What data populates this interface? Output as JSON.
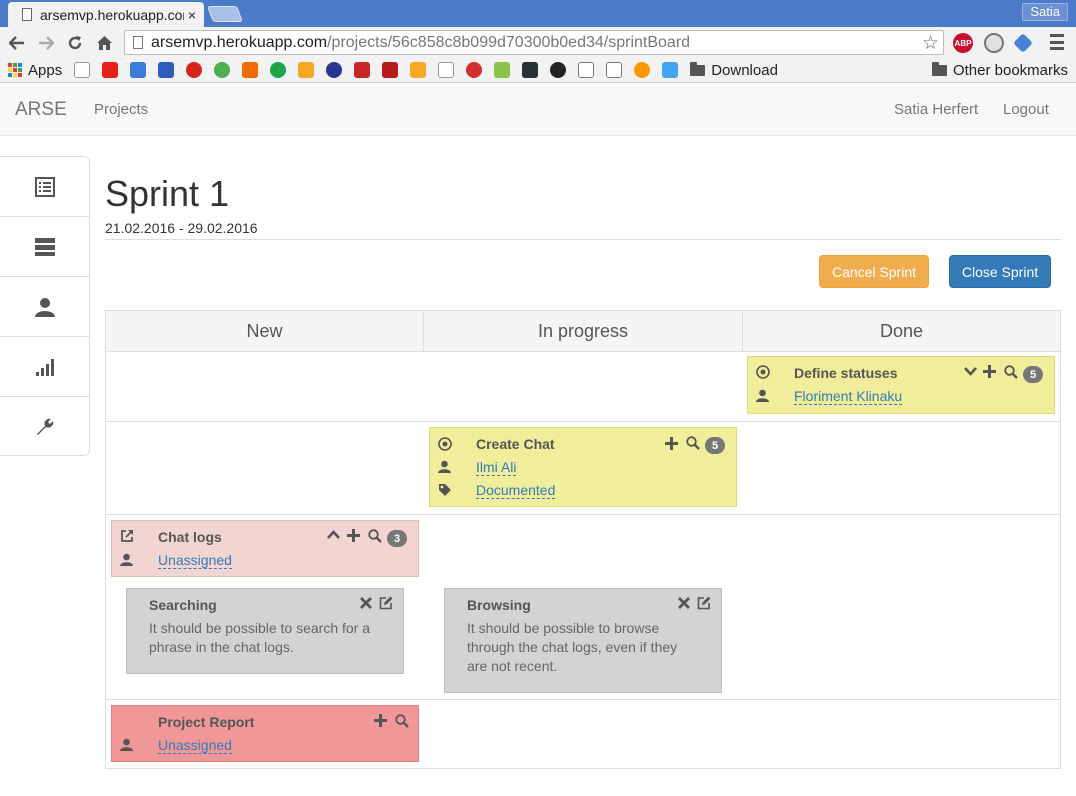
{
  "browser": {
    "tab_title": "arsemvp.herokuapp.com/projects/56c858c8b099d70300b0ed34/sprintBoard",
    "tab_close": "×",
    "profile": "Satia",
    "url_host": "arsemvp.herokuapp.com",
    "url_path": "/projects/56c858c8b099d70300b0ed34/sprintBoard",
    "abp_label": "ABP",
    "bookmarks": {
      "apps": "Apps",
      "download": "Download",
      "other": "Other bookmarks"
    }
  },
  "navbar": {
    "brand": "ARSE",
    "projects": "Projects",
    "user": "Satia Herfert",
    "logout": "Logout"
  },
  "sidebar": {
    "items": [
      "list-icon",
      "server-icon",
      "user-icon",
      "stats-icon",
      "wrench-icon"
    ]
  },
  "sprint": {
    "title": "Sprint 1",
    "dates": "21.02.2016 - 29.02.2016",
    "cancel_label": "Cancel Sprint",
    "close_label": "Close Sprint"
  },
  "board": {
    "columns": [
      "New",
      "In progress",
      "Done"
    ],
    "cards": {
      "define_statuses": {
        "title": "Define statuses",
        "assignee": "Floriment Klinaku",
        "points": "5"
      },
      "create_chat": {
        "title": "Create Chat",
        "assignee": "Ilmi Ali",
        "tag": "Documented",
        "points": "5"
      },
      "chat_logs": {
        "title": "Chat logs",
        "assignee": "Unassigned",
        "points": "3"
      },
      "searching": {
        "title": "Searching",
        "text": "It should be possible to search for a phrase in the chat logs."
      },
      "browsing": {
        "title": "Browsing",
        "text": "It should be possible to browse through the chat logs, even if they are not recent."
      },
      "project_report": {
        "title": "Project Report",
        "assignee": "Unassigned"
      }
    }
  },
  "colors": {
    "card_yellow": "#f0ee9a",
    "card_pink": "#f2d4d0",
    "card_red": "#f09898",
    "card_gray": "#d3d3d3",
    "btn_warning": "#f0ad4e",
    "btn_primary": "#337ab7"
  }
}
